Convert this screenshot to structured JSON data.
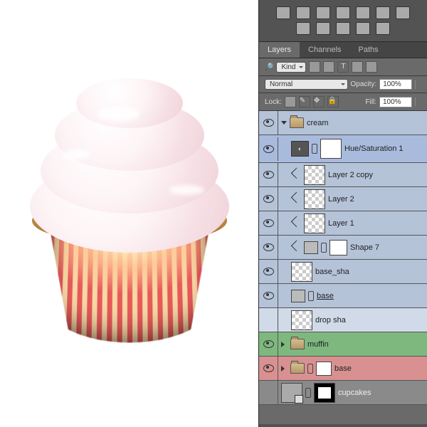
{
  "tabs": [
    "Layers",
    "Channels",
    "Paths"
  ],
  "active_tab": 0,
  "filter": {
    "kind": "Kind"
  },
  "blend": {
    "mode": "Normal",
    "opacity_label": "Opacity:",
    "opacity": "100%",
    "fill_label": "Fill:",
    "fill": "100%",
    "lock_label": "Lock:"
  },
  "groups": {
    "cream": "cream",
    "muffin": "muffin",
    "base": "base"
  },
  "layers": {
    "hue": "Hue/Saturation 1",
    "l2c": "Layer 2 copy",
    "l2": "Layer 2",
    "l1": "Layer 1",
    "s7": "Shape 7",
    "bsha": "base_sha",
    "base": "base",
    "drop": "drop sha",
    "cup": "cupcakes"
  }
}
